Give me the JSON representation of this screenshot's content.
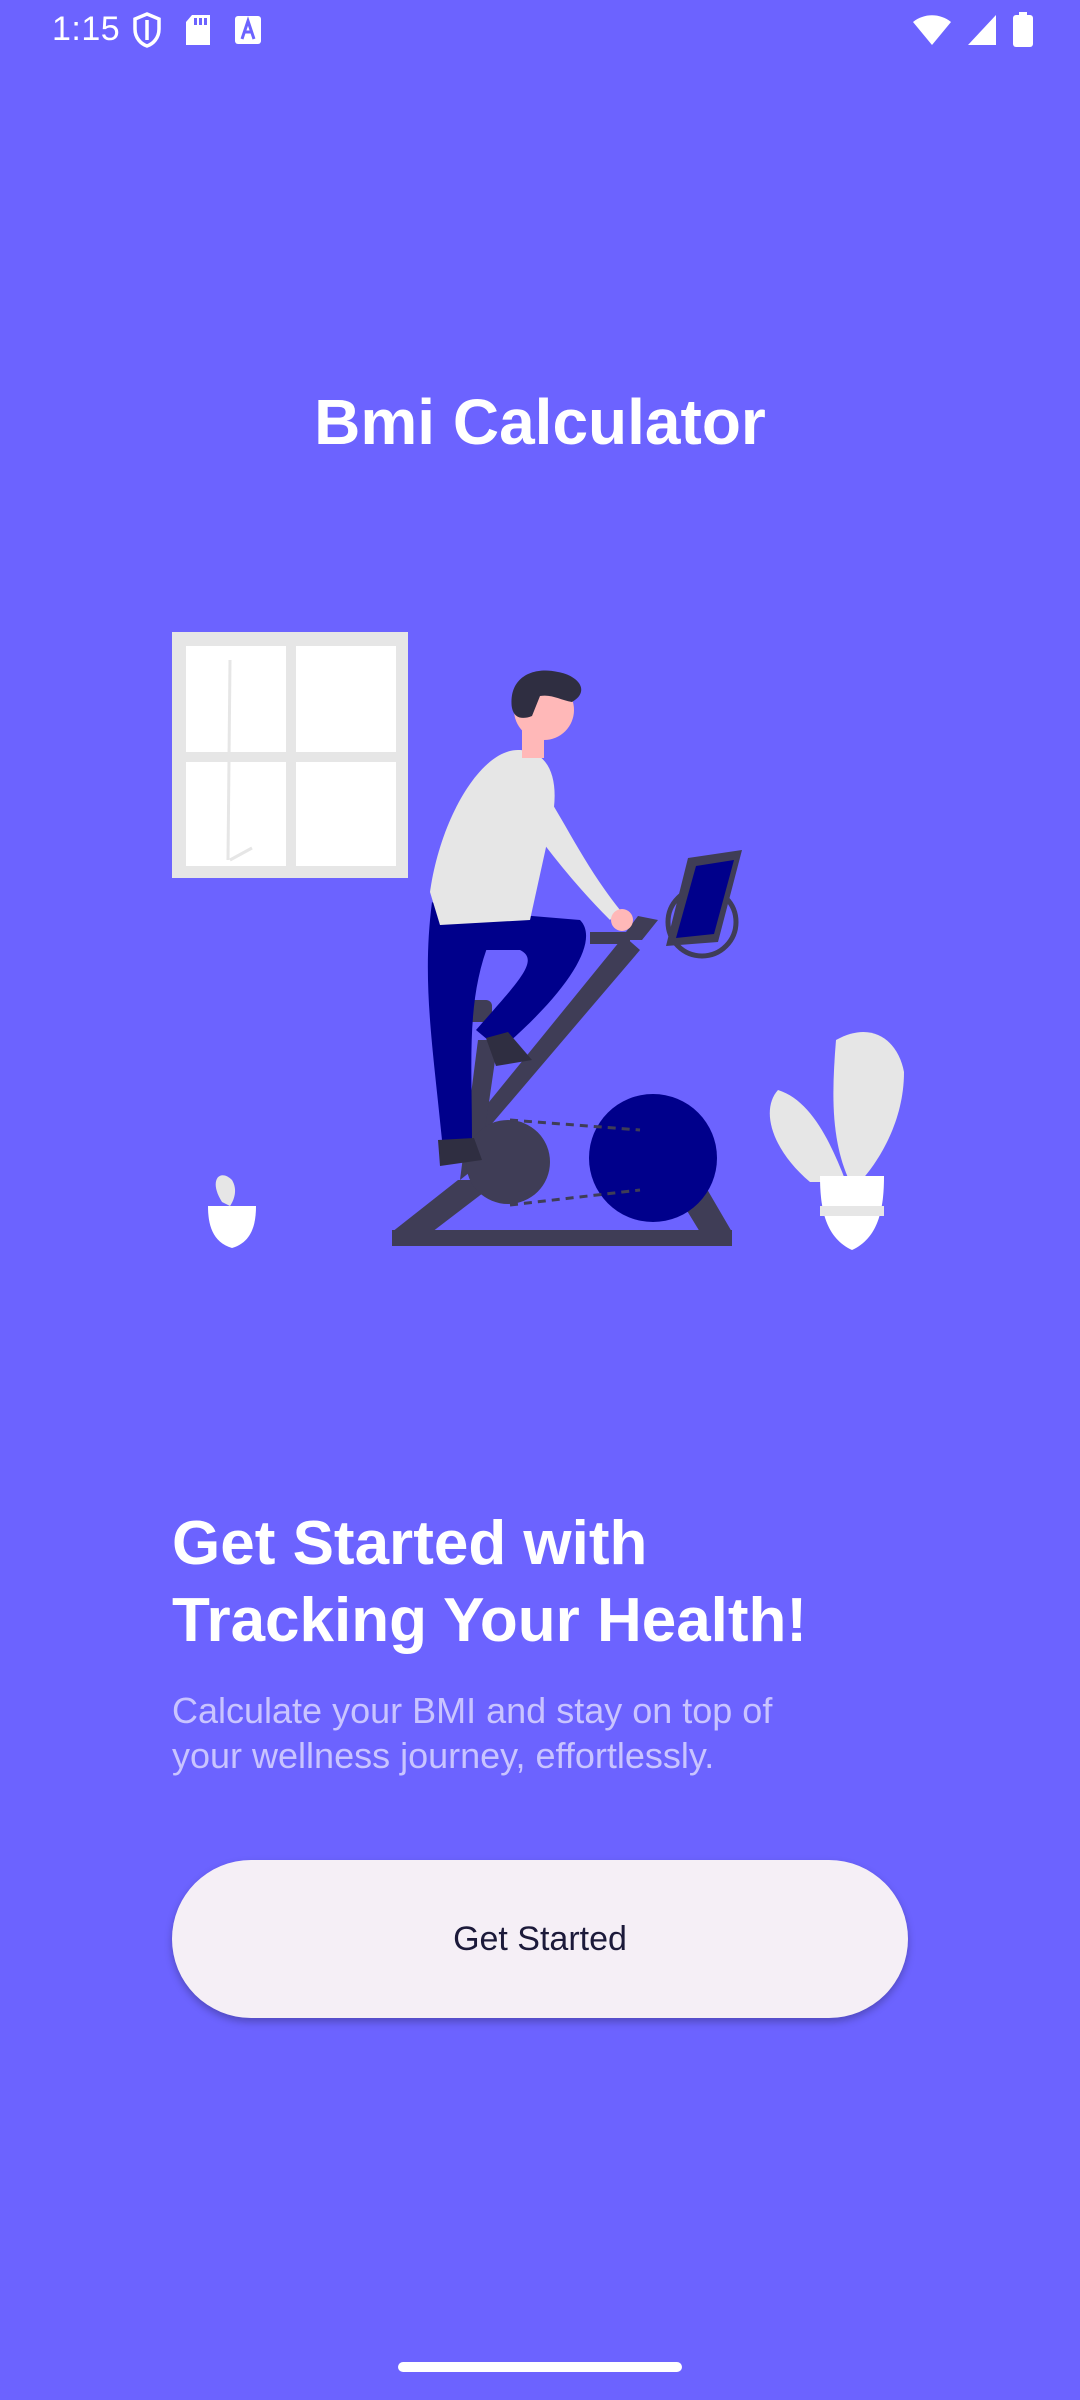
{
  "status_bar": {
    "time": "1:15",
    "icons_left": [
      "shield-icon",
      "sd-card-icon",
      "accessibility-a-icon"
    ],
    "icons_right": [
      "wifi-icon",
      "cellular-signal-icon",
      "battery-icon"
    ]
  },
  "app": {
    "title": "Bmi Calculator"
  },
  "onboarding": {
    "illustration": "person-on-exercise-bike",
    "headline_line1": "Get Started with",
    "headline_line2": "Tracking Your Health!",
    "subtitle_line1": "Calculate your BMI and stay on top of",
    "subtitle_line2": "your wellness journey, effortlessly.",
    "cta_label": "Get Started"
  },
  "colors": {
    "background": "#6c63ff",
    "button": "#f5eff6",
    "button_text": "#1c1a3a",
    "subtitle": "#c9c4ff"
  }
}
